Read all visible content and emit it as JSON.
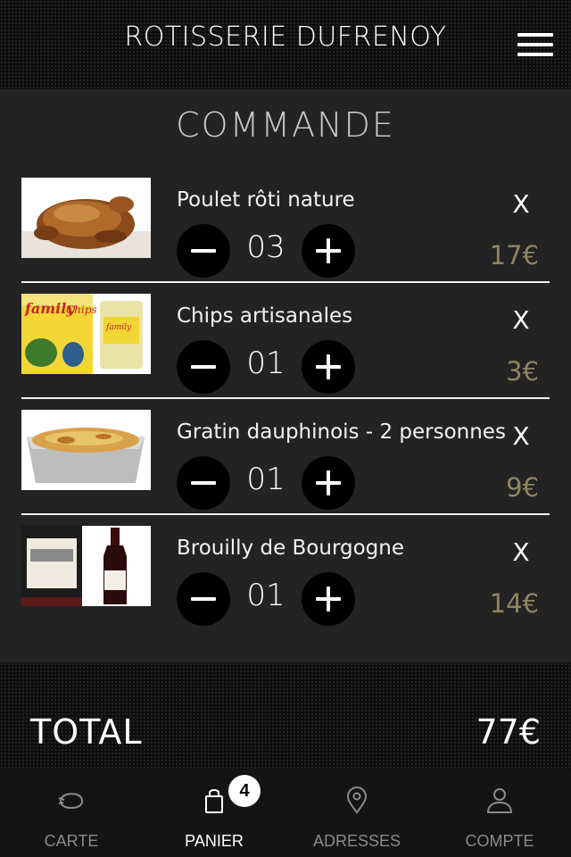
{
  "header": {
    "title": "ROTISSERIE DUFRENOY",
    "menu_icon": "hamburger-menu-icon"
  },
  "order": {
    "title": "COMMANDE",
    "items": [
      {
        "name": "Poulet rôti nature",
        "qty": "03",
        "price": "17€",
        "remove": "X",
        "image": "roast-chicken"
      },
      {
        "name": "Chips artisanales",
        "qty": "01",
        "price": "3€",
        "remove": "X",
        "image": "chips-bag"
      },
      {
        "name": "Gratin dauphinois - 2 personnes",
        "qty": "01",
        "price": "9€",
        "remove": "X",
        "image": "gratin-tray"
      },
      {
        "name": "Brouilly de Bourgogne",
        "qty": "01",
        "price": "14€",
        "remove": "X",
        "image": "wine-bottle"
      }
    ]
  },
  "total": {
    "label": "TOTAL",
    "value": "77€"
  },
  "nav": {
    "items": [
      {
        "label": "CARTE",
        "icon": "chicken-icon",
        "active": false
      },
      {
        "label": "PANIER",
        "icon": "shopping-bag-icon",
        "active": true,
        "badge": "4"
      },
      {
        "label": "ADRESSES",
        "icon": "map-pin-icon",
        "active": false
      },
      {
        "label": "COMPTE",
        "icon": "user-icon",
        "active": false
      }
    ]
  },
  "colors": {
    "price": "#8d8560",
    "panel": "#232323",
    "background": "#0e0e0e"
  }
}
